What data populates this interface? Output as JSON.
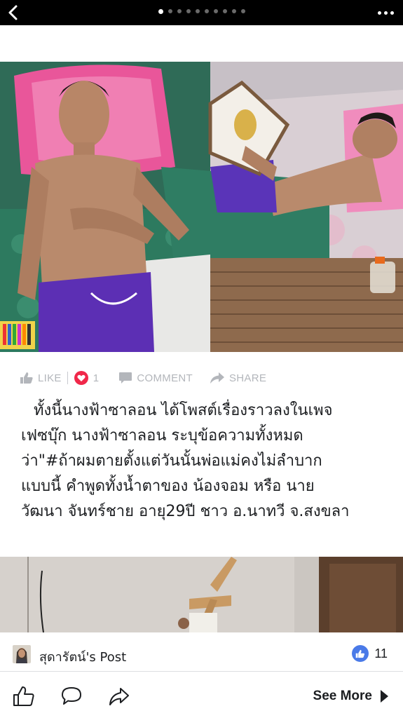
{
  "topbar": {
    "back_icon": "chevron-left-icon",
    "page_dots_total": 10,
    "page_dots_active_index": 0,
    "more_icon": "more-horizontal-icon"
  },
  "actions": {
    "like_label": "LIKE",
    "love_count": "1",
    "comment_label": "COMMENT",
    "share_label": "SHARE"
  },
  "caption": {
    "line1": "ทั้งนี้นางฟ้าซาลอน ได้โพสต์เรื่องราวลงในเพจ",
    "line2": "เฟซบุ๊ก นางฟ้าซาลอน ระบุข้อความทั้งหมด",
    "line3": "ว่า\"#ถ้าผมตายตั้งแต่วันนั้นพ่อแม่คงไม่ลำบาก",
    "line4": "แบบนี้ คำพูดทั้งน้ำตาของ น้องจอม หรือ นาย",
    "line5": "วัฒนา จันทร์ชาย อายุ29ปี ชาว อ.นาทวี จ.สงขลา"
  },
  "source": {
    "label": "สุดารัตน์'s Post",
    "like_count": "11"
  },
  "bottombar": {
    "see_more_label": "See More"
  },
  "colors": {
    "like_blue": "#4a7ae8",
    "love_red": "#f0284a",
    "muted_gray": "#b3b6bb"
  }
}
